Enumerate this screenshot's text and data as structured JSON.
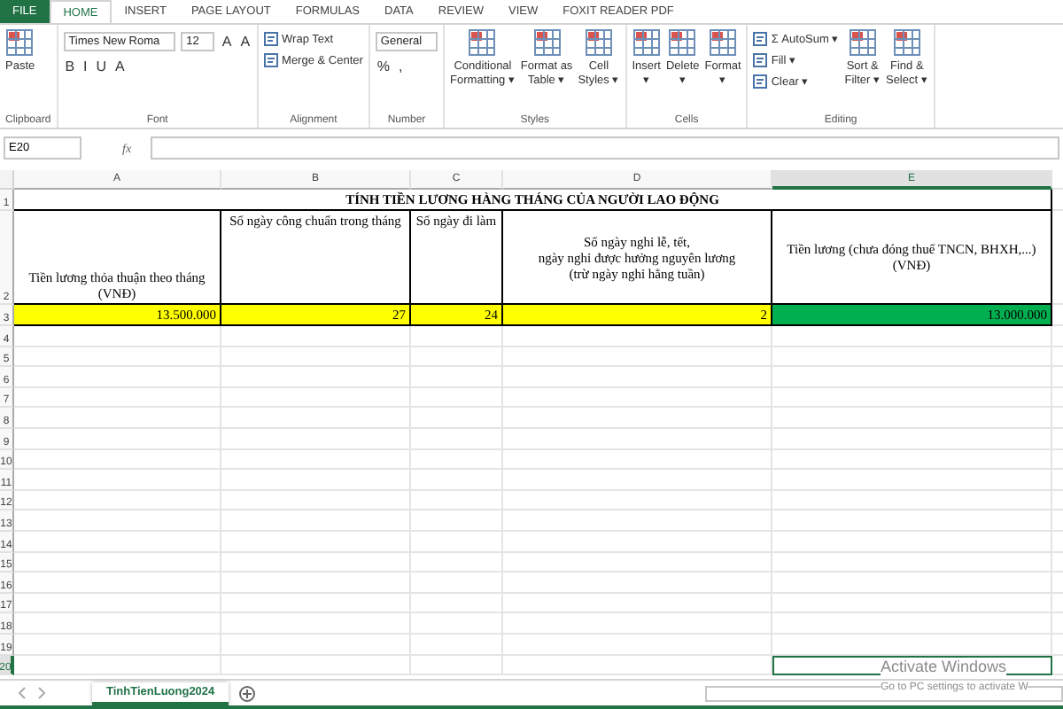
{
  "ribbon_tabs": [
    {
      "label": "FILE",
      "kind": "file",
      "selected": false
    },
    {
      "label": "HOME",
      "kind": "tab",
      "selected": true
    },
    {
      "label": "INSERT",
      "kind": "tab",
      "selected": false
    },
    {
      "label": "PAGE LAYOUT",
      "kind": "tab",
      "selected": false
    },
    {
      "label": "FORMULAS",
      "kind": "tab",
      "selected": false
    },
    {
      "label": "DATA",
      "kind": "tab",
      "selected": false
    },
    {
      "label": "REVIEW",
      "kind": "tab",
      "selected": false
    },
    {
      "label": "VIEW",
      "kind": "tab",
      "selected": false
    },
    {
      "label": "FOXIT READER PDF",
      "kind": "tab",
      "selected": false
    }
  ],
  "ribbon_groups": [
    {
      "label": "Clipboard",
      "items": [
        {
          "kind": "large",
          "lines": [
            "Paste"
          ]
        }
      ]
    },
    {
      "label": "Font",
      "items": [
        {
          "kind": "dropdown",
          "value": "Times New Roma"
        },
        {
          "kind": "dropdown",
          "value": "12"
        },
        {
          "kind": "glyph",
          "text": "A"
        },
        {
          "kind": "glyph",
          "text": "A"
        },
        {
          "kind": "break"
        },
        {
          "kind": "glyph",
          "text": "B"
        },
        {
          "kind": "glyph",
          "text": "I"
        },
        {
          "kind": "glyph",
          "text": "U"
        },
        {
          "kind": "glyph",
          "text": "A"
        }
      ]
    },
    {
      "label": "Alignment",
      "items": [
        {
          "kind": "small",
          "text": "Wrap Text"
        },
        {
          "kind": "small",
          "text": "Merge & Center"
        }
      ]
    },
    {
      "label": "Number",
      "items": [
        {
          "kind": "dropdown",
          "value": "General"
        },
        {
          "kind": "break"
        },
        {
          "kind": "glyph",
          "text": "%"
        },
        {
          "kind": "glyph",
          "text": ","
        }
      ]
    },
    {
      "label": "Styles",
      "items": [
        {
          "kind": "large",
          "lines": [
            "Conditional",
            "Formatting ▾"
          ]
        },
        {
          "kind": "large",
          "lines": [
            "Format as",
            "Table ▾"
          ]
        },
        {
          "kind": "large",
          "lines": [
            "Cell",
            "Styles ▾"
          ]
        }
      ]
    },
    {
      "label": "Cells",
      "items": [
        {
          "kind": "large",
          "lines": [
            "Insert",
            "▾"
          ]
        },
        {
          "kind": "large",
          "lines": [
            "Delete",
            "▾"
          ]
        },
        {
          "kind": "large",
          "lines": [
            "Format",
            "▾"
          ]
        }
      ]
    },
    {
      "label": "Editing",
      "items": [
        {
          "kind": "small",
          "text": "Σ AutoSum ▾"
        },
        {
          "kind": "small",
          "text": "Fill ▾"
        },
        {
          "kind": "small",
          "text": "Clear ▾"
        },
        {
          "kind": "large",
          "lines": [
            "Sort &",
            "Filter ▾"
          ]
        },
        {
          "kind": "large",
          "lines": [
            "Find &",
            "Select ▾"
          ]
        }
      ]
    }
  ],
  "formula_bar": {
    "name_box": "E20",
    "function_label": "fx"
  },
  "sheet": {
    "columns": [
      {
        "label": "A",
        "selected": false
      },
      {
        "label": "B",
        "selected": false
      },
      {
        "label": "C",
        "selected": false
      },
      {
        "label": "D",
        "selected": false
      },
      {
        "label": "E",
        "selected": true
      }
    ],
    "row_numbers": [
      {
        "label": "1",
        "selected": false
      },
      {
        "label": "2",
        "selected": false
      },
      {
        "label": "3",
        "selected": false
      },
      {
        "label": "4",
        "selected": false
      },
      {
        "label": "5",
        "selected": false
      },
      {
        "label": "6",
        "selected": false
      },
      {
        "label": "7",
        "selected": false
      },
      {
        "label": "8",
        "selected": false
      },
      {
        "label": "9",
        "selected": false
      },
      {
        "label": "10",
        "selected": false
      },
      {
        "label": "11",
        "selected": false
      },
      {
        "label": "12",
        "selected": false
      },
      {
        "label": "13",
        "selected": false
      },
      {
        "label": "14",
        "selected": false
      },
      {
        "label": "15",
        "selected": false
      },
      {
        "label": "16",
        "selected": false
      },
      {
        "label": "17",
        "selected": false
      },
      {
        "label": "18",
        "selected": false
      },
      {
        "label": "19",
        "selected": false
      },
      {
        "label": "20",
        "selected": true
      }
    ],
    "title": "TÍNH TIỀN LƯƠNG HÀNG THÁNG CỦA NGƯỜI LAO ĐỘNG",
    "headers": [
      {
        "text": "Tiền lương thỏa thuận theo tháng\n(VNĐ)",
        "kind": "bottom"
      },
      {
        "text": "Số ngày công chuẩn trong tháng",
        "kind": "top"
      },
      {
        "text": "Số ngày đi làm",
        "kind": "top"
      },
      {
        "text": "Số ngày nghỉ lễ, tết,\nngày nghỉ được hưởng nguyên lương\n(trừ ngày nghỉ hằng tuần)",
        "kind": "middle"
      },
      {
        "text": "Tiền lương (chưa đóng thuế TNCN, BHXH,...)\n(VNĐ)",
        "kind": "middle"
      }
    ],
    "values": [
      {
        "text": "13.500.000",
        "color": "#ffff00"
      },
      {
        "text": "27",
        "color": "#ffff00"
      },
      {
        "text": "24",
        "color": "#ffff00"
      },
      {
        "text": "2",
        "color": "#ffff00"
      },
      {
        "text": "13.000.000",
        "color": "#00b050"
      }
    ]
  },
  "sheet_tabs": [
    {
      "label": "TinhTienLuong2024",
      "selected": true
    }
  ],
  "activation_notice": {
    "title": "Activate Windows",
    "message": "Go to PC settings to activate W"
  }
}
